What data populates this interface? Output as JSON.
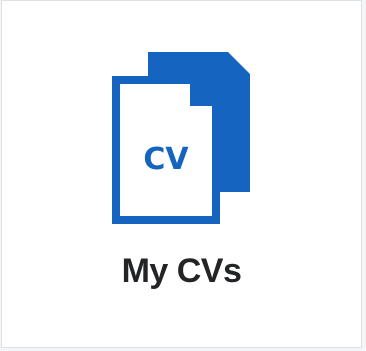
{
  "tile": {
    "label": "My CVs",
    "icon": "cv-documents-icon",
    "icon_text": "CV",
    "accent_color": "#1565c0"
  }
}
